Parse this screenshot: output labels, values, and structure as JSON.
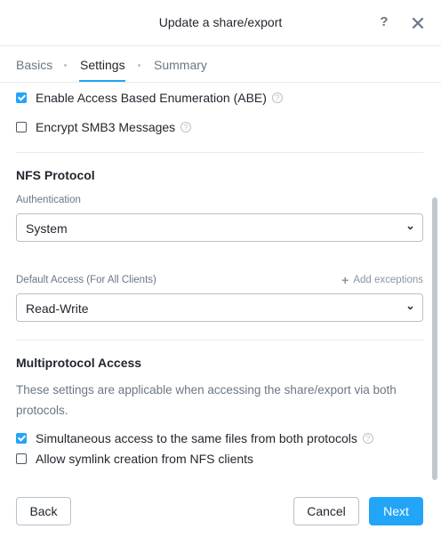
{
  "dialog": {
    "title": "Update a share/export",
    "help_icon": "?",
    "close_icon": "close-icon"
  },
  "tabs": [
    {
      "label": "Basics",
      "active": false
    },
    {
      "label": "Settings",
      "active": true
    },
    {
      "label": "Summary",
      "active": false
    }
  ],
  "smb": {
    "abe": {
      "label": "Enable Access Based Enumeration (ABE)",
      "checked": true
    },
    "encrypt": {
      "label": "Encrypt SMB3 Messages",
      "checked": false
    }
  },
  "nfs": {
    "title": "NFS Protocol",
    "auth_label": "Authentication",
    "auth_value": "System",
    "access_label": "Default Access (For All Clients)",
    "add_exceptions": "Add exceptions",
    "access_value": "Read-Write"
  },
  "multiprotocol": {
    "title": "Multiprotocol Access",
    "description": "These settings are applicable when accessing the share/export via both protocols.",
    "simultaneous": {
      "label": "Simultaneous access to the same files from both protocols",
      "checked": true
    },
    "symlink": {
      "label": "Allow symlink creation from NFS clients",
      "checked": false
    }
  },
  "footer": {
    "back": "Back",
    "cancel": "Cancel",
    "next": "Next"
  },
  "colors": {
    "accent": "#22a5f7",
    "text": "#22272e",
    "muted": "#6b7785",
    "border": "#b8c1cb"
  }
}
